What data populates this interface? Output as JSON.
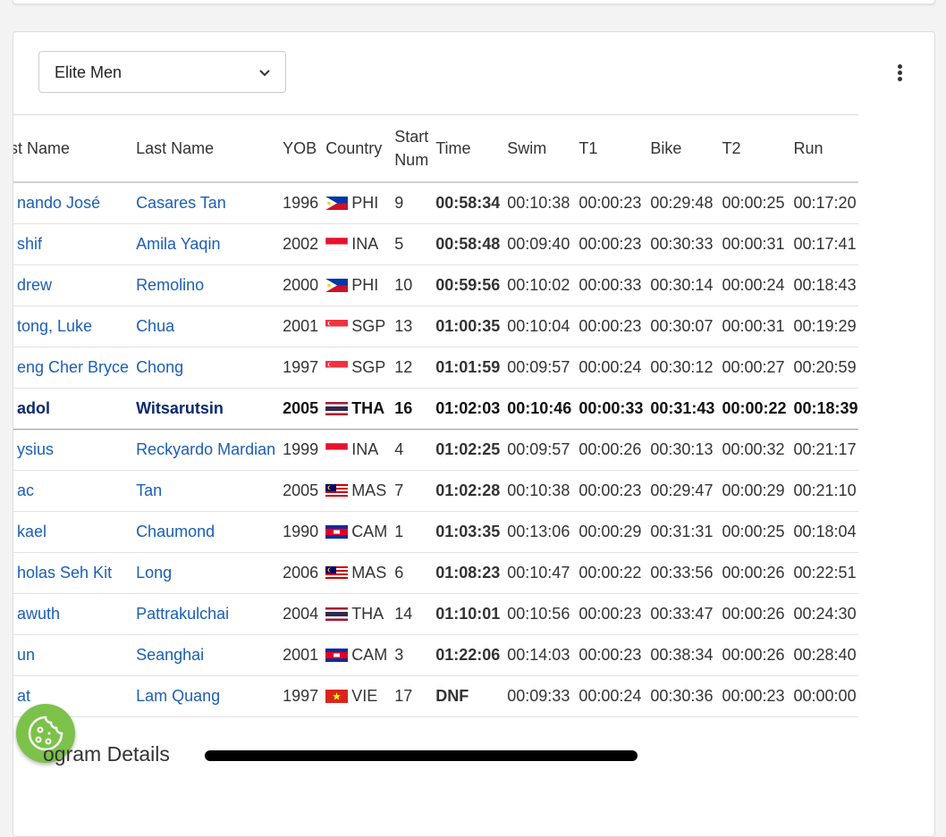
{
  "filter": {
    "selected": "Elite Men"
  },
  "table": {
    "headers": {
      "first_name": "st Name",
      "last_name": "Last Name",
      "yob": "YOB",
      "country": "Country",
      "start_line1": "Start",
      "start_line2": "Num",
      "time": "Time",
      "swim": "Swim",
      "t1": "T1",
      "bike": "Bike",
      "t2": "T2",
      "run": "Run"
    },
    "rows": [
      {
        "first": "nando José",
        "last": "Casares Tan",
        "yob": "1996",
        "flag": "PHI",
        "country": "PHI",
        "start": "9",
        "time": "00:58:34",
        "swim": "00:10:38",
        "t1": "00:00:23",
        "bike": "00:29:48",
        "t2": "00:00:25",
        "run": "00:17:20"
      },
      {
        "first": "shif",
        "last": "Amila Yaqin",
        "yob": "2002",
        "flag": "INA",
        "country": "INA",
        "start": "5",
        "time": "00:58:48",
        "swim": "00:09:40",
        "t1": "00:00:23",
        "bike": "00:30:33",
        "t2": "00:00:31",
        "run": "00:17:41"
      },
      {
        "first": "drew",
        "last": "Remolino",
        "yob": "2000",
        "flag": "PHI",
        "country": "PHI",
        "start": "10",
        "time": "00:59:56",
        "swim": "00:10:02",
        "t1": "00:00:33",
        "bike": "00:30:14",
        "t2": "00:00:24",
        "run": "00:18:43"
      },
      {
        "first": "tong, Luke",
        "last": "Chua",
        "yob": "2001",
        "flag": "SGP",
        "country": "SGP",
        "start": "13",
        "time": "01:00:35",
        "swim": "00:10:04",
        "t1": "00:00:23",
        "bike": "00:30:07",
        "t2": "00:00:31",
        "run": "00:19:29"
      },
      {
        "first": "eng Cher Bryce",
        "last": "Chong",
        "yob": "1997",
        "flag": "SGP",
        "country": "SGP",
        "start": "12",
        "time": "01:01:59",
        "swim": "00:09:57",
        "t1": "00:00:24",
        "bike": "00:30:12",
        "t2": "00:00:27",
        "run": "00:20:59"
      },
      {
        "first": "adol",
        "last": "Witsarutsin",
        "yob": "2005",
        "flag": "THA",
        "country": "THA",
        "start": "16",
        "time": "01:02:03",
        "swim": "00:10:46",
        "t1": "00:00:33",
        "bike": "00:31:43",
        "t2": "00:00:22",
        "run": "00:18:39"
      },
      {
        "first": "ysius",
        "last": "Reckyardo Mardian",
        "yob": "1999",
        "flag": "INA",
        "country": "INA",
        "start": "4",
        "time": "01:02:25",
        "swim": "00:09:57",
        "t1": "00:00:26",
        "bike": "00:30:13",
        "t2": "00:00:32",
        "run": "00:21:17"
      },
      {
        "first": "ac",
        "last": "Tan",
        "yob": "2005",
        "flag": "MAS",
        "country": "MAS",
        "start": "7",
        "time": "01:02:28",
        "swim": "00:10:38",
        "t1": "00:00:23",
        "bike": "00:29:47",
        "t2": "00:00:29",
        "run": "00:21:10"
      },
      {
        "first": "kael",
        "last": "Chaumond",
        "yob": "1990",
        "flag": "CAM",
        "country": "CAM",
        "start": "1",
        "time": "01:03:35",
        "swim": "00:13:06",
        "t1": "00:00:29",
        "bike": "00:31:31",
        "t2": "00:00:25",
        "run": "00:18:04"
      },
      {
        "first": "holas Seh Kit",
        "last": "Long",
        "yob": "2006",
        "flag": "MAS",
        "country": "MAS",
        "start": "6",
        "time": "01:08:23",
        "swim": "00:10:47",
        "t1": "00:00:22",
        "bike": "00:33:56",
        "t2": "00:00:26",
        "run": "00:22:51"
      },
      {
        "first": "awuth",
        "last": "Pattrakulchai",
        "yob": "2004",
        "flag": "THA",
        "country": "THA",
        "start": "14",
        "time": "01:10:01",
        "swim": "00:10:56",
        "t1": "00:00:23",
        "bike": "00:33:47",
        "t2": "00:00:26",
        "run": "00:24:30"
      },
      {
        "first": "un",
        "last": "Seanghai",
        "yob": "2001",
        "flag": "CAM",
        "country": "CAM",
        "start": "3",
        "time": "01:22:06",
        "swim": "00:14:03",
        "t1": "00:00:23",
        "bike": "00:38:34",
        "t2": "00:00:26",
        "run": "00:28:40"
      },
      {
        "first": "at",
        "last": "Lam Quang",
        "yob": "1997",
        "flag": "VIE",
        "country": "VIE",
        "start": "17",
        "time": "DNF",
        "swim": "00:09:33",
        "t1": "00:00:24",
        "bike": "00:30:36",
        "t2": "00:00:23",
        "run": "00:00:00"
      }
    ],
    "highlighted_row": 5
  },
  "footer": {
    "section_title": "ogram Details"
  },
  "icons": {
    "dropdown": "chevron-down-icon",
    "menu": "kebab-menu-icon",
    "fab": "cookie-icon"
  },
  "colors": {
    "link": "#1b5fb5",
    "fab": "#7cc24a"
  }
}
